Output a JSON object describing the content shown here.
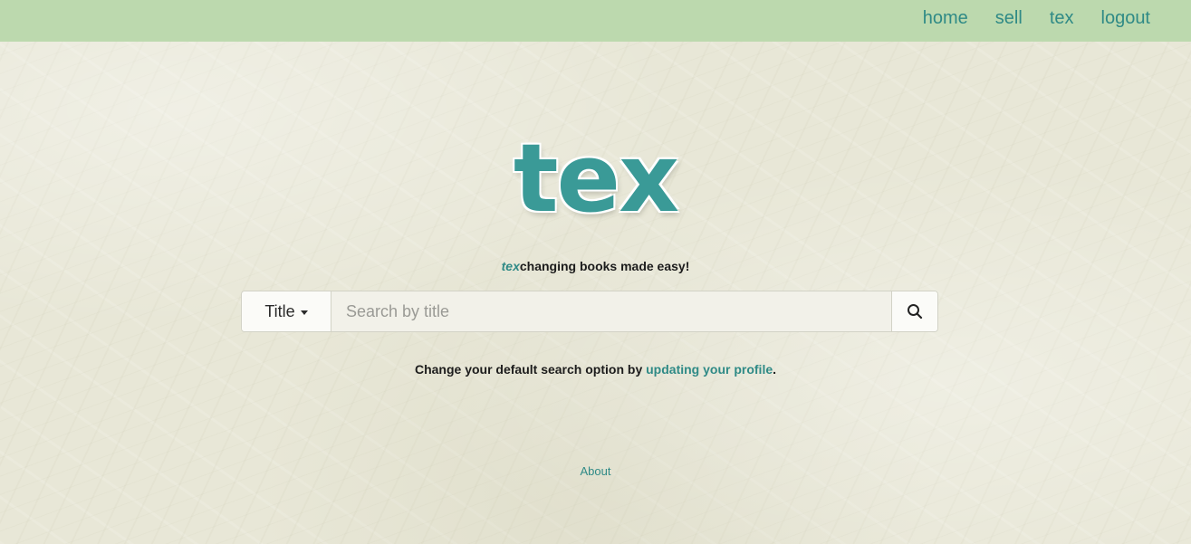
{
  "nav": {
    "items": [
      {
        "label": "home"
      },
      {
        "label": "sell"
      },
      {
        "label": "tex"
      },
      {
        "label": "logout"
      }
    ]
  },
  "logo": {
    "text": "tex"
  },
  "tagline": {
    "brand": "tex",
    "rest": "changing books made easy!"
  },
  "search": {
    "type_label": "Title",
    "placeholder": "Search by title",
    "value": "",
    "icon": "search-icon"
  },
  "hint": {
    "before": "Change your default search option by ",
    "link": "updating your profile",
    "after": "."
  },
  "footer": {
    "about_label": "About"
  },
  "colors": {
    "accent": "#2f8a86",
    "topbar": "#bcd9ae",
    "logo": "#3a9a97",
    "background": "#e8e7d7"
  }
}
